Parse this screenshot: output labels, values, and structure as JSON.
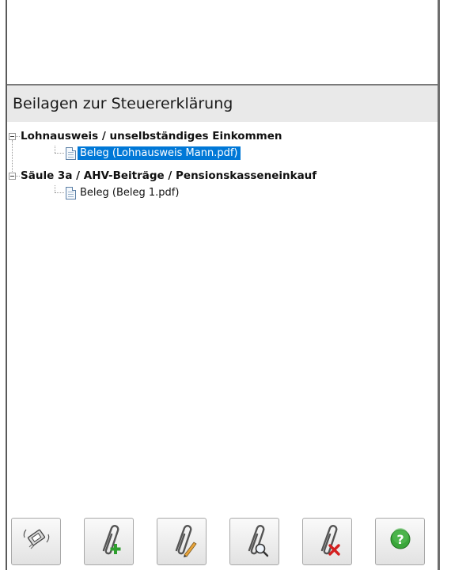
{
  "panel": {
    "title": "Beilagen zur Steuererklärung"
  },
  "tree": {
    "groups": [
      {
        "label": "Lohnausweis / unselbständiges Einkommen",
        "expanded": true,
        "items": [
          {
            "label": "Beleg (Lohnausweis Mann.pdf)",
            "selected": true,
            "icon": "document-icon"
          }
        ]
      },
      {
        "label": "Säule 3a / AHV-Beiträge / Pensionskasseneinkauf",
        "expanded": true,
        "items": [
          {
            "label": "Beleg (Beleg 1.pdf)",
            "selected": false,
            "icon": "document-icon"
          }
        ]
      }
    ]
  },
  "toolbar": {
    "buttons": [
      {
        "name": "scan-button",
        "icon": "scan-icon"
      },
      {
        "name": "add-attachment-button",
        "icon": "paperclip-add-icon"
      },
      {
        "name": "edit-attachment-button",
        "icon": "paperclip-edit-icon"
      },
      {
        "name": "view-attachment-button",
        "icon": "paperclip-search-icon"
      },
      {
        "name": "delete-attachment-button",
        "icon": "paperclip-delete-icon"
      },
      {
        "name": "help-button",
        "icon": "help-icon"
      }
    ]
  },
  "colors": {
    "selection": "#0078d7",
    "header_background": "#e9e9e9",
    "help_green": "#3aa63a",
    "add_green": "#2e9e2e",
    "delete_red": "#d42020"
  }
}
